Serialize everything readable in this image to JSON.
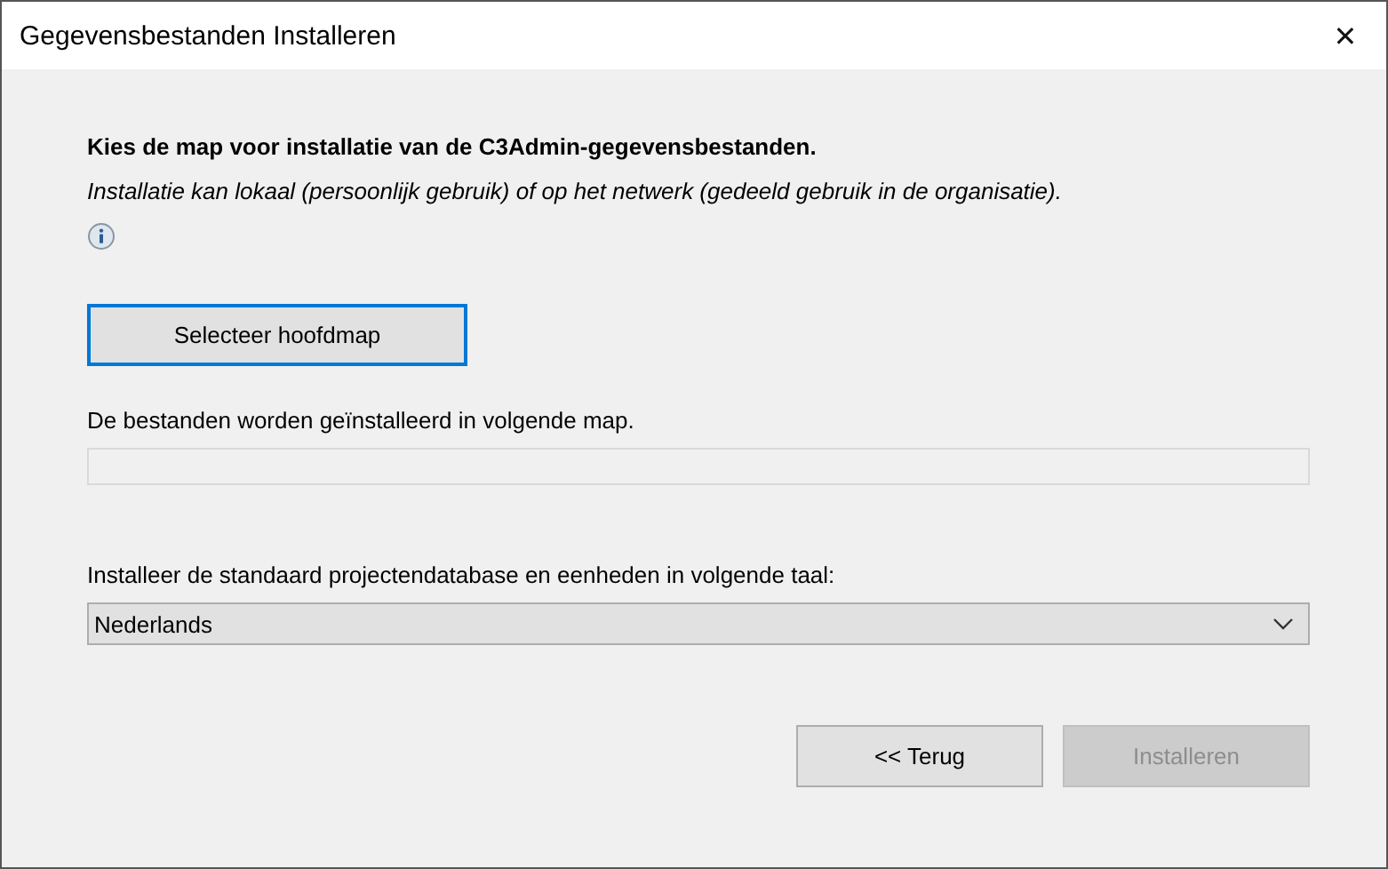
{
  "window": {
    "title": "Gegevensbestanden Installeren",
    "close": "✕"
  },
  "heading": "Kies de map voor installatie van de C3Admin-gegevensbestanden.",
  "description": "Installatie kan lokaal (persoonlijk gebruik) of op het netwerk (gedeeld gebruik in de organisatie).",
  "select_button": {
    "label": "Selecteer hoofdmap",
    "focused": true
  },
  "path_label": "De bestanden worden geïnstalleerd in volgende map.",
  "language_label": "Installeer de standaard projectendatabase en eenheden in volgende taal:",
  "language_dropdown": {
    "value": "Nederlands"
  },
  "buttons": [
    {
      "label": "<< Terug",
      "disabled": false
    },
    {
      "label": "Installeren",
      "disabled": true
    }
  ]
}
